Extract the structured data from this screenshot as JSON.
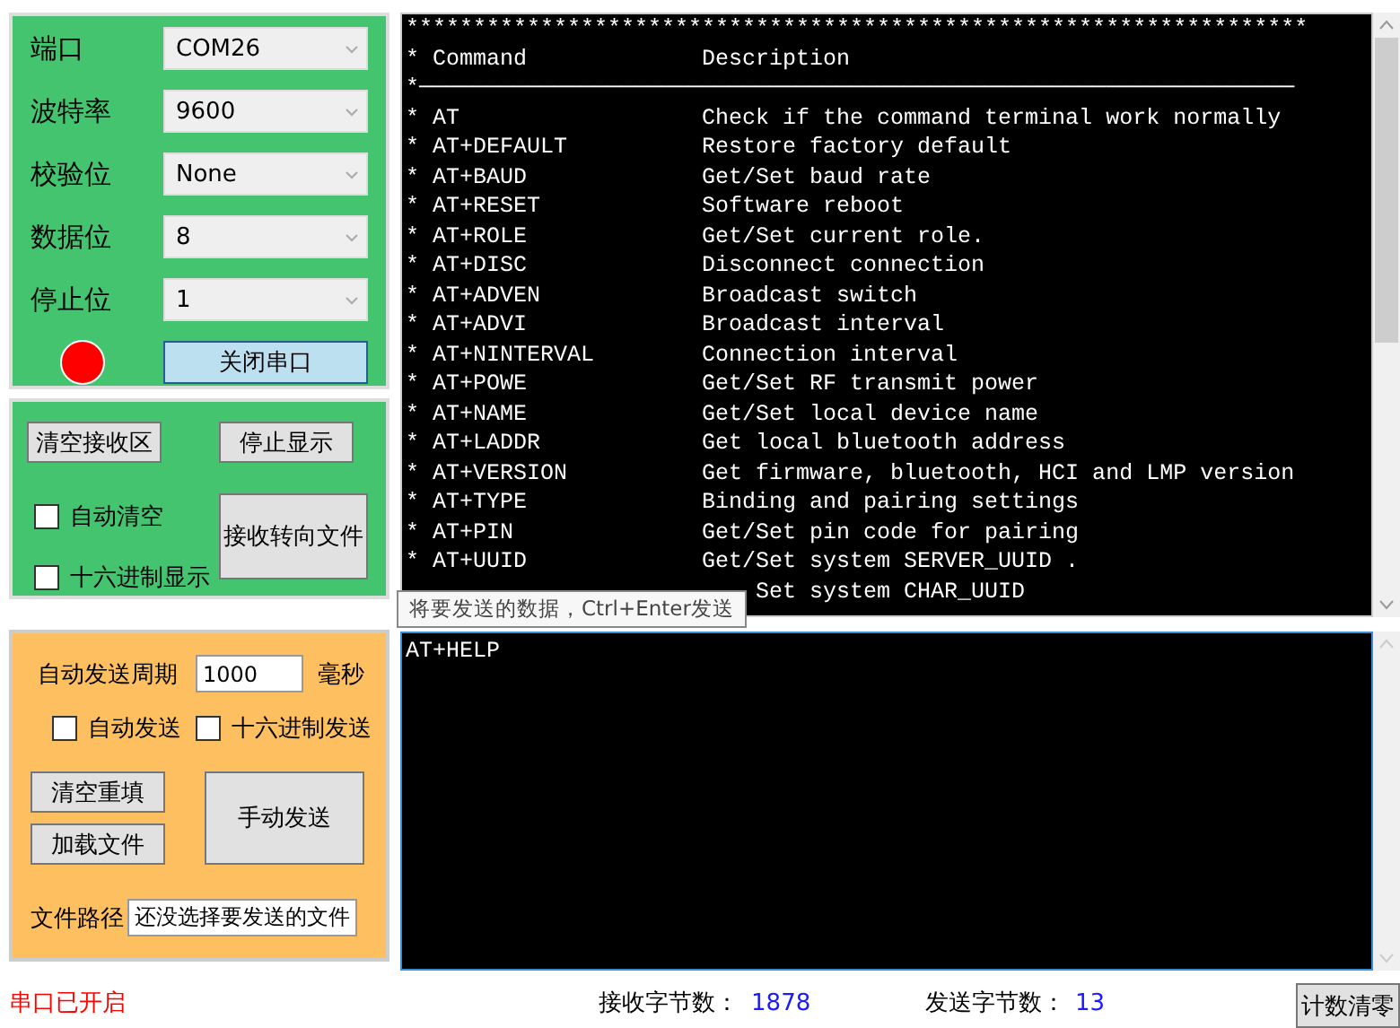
{
  "serial_settings": {
    "fields": [
      {
        "label": "端口",
        "value": "COM26"
      },
      {
        "label": "波特率",
        "value": "9600"
      },
      {
        "label": "校验位",
        "value": "None"
      },
      {
        "label": "数据位",
        "value": "8"
      },
      {
        "label": "停止位",
        "value": "1"
      }
    ],
    "port_button": "关闭串口"
  },
  "receive_options": {
    "clear_button": "清空接收区",
    "stop_button": "停止显示",
    "checkboxes": [
      {
        "label": "自动清空",
        "checked": false
      },
      {
        "label": "十六进制显示",
        "checked": false
      }
    ],
    "redirect_button": "接收转向文件"
  },
  "send_options": {
    "period_label": "自动发送周期",
    "period_value": "1000",
    "period_unit": "毫秒",
    "checkboxes": [
      {
        "label": "自动发送",
        "checked": false
      },
      {
        "label": "十六进制发送",
        "checked": false
      }
    ],
    "reset_button": "清空重填",
    "load_button": "加载文件",
    "send_button": "手动发送",
    "file_path_label": "文件路径",
    "file_path_value": "还没选择要发送的文件"
  },
  "receive_terminal": {
    "lines": [
      {
        "kind": "full",
        "text": "*******************************************************************"
      },
      {
        "kind": "full",
        "text": "* Command             Description"
      },
      {
        "kind": "full",
        "text": "*─────────────────────────────────────────────────────────────────"
      },
      {
        "kind": "full",
        "text": "* AT                  Check if the command terminal work normally"
      },
      {
        "kind": "full",
        "text": "* AT+DEFAULT          Restore factory default"
      },
      {
        "kind": "full",
        "text": "* AT+BAUD             Get/Set baud rate"
      },
      {
        "kind": "full",
        "text": "* AT+RESET            Software reboot"
      },
      {
        "kind": "full",
        "text": "* AT+ROLE             Get/Set current role."
      },
      {
        "kind": "full",
        "text": "* AT+DISC             Disconnect connection"
      },
      {
        "kind": "full",
        "text": "* AT+ADVEN            Broadcast switch"
      },
      {
        "kind": "full",
        "text": "* AT+ADVI             Broadcast interval"
      },
      {
        "kind": "full",
        "text": "* AT+NINTERVAL        Connection interval"
      },
      {
        "kind": "full",
        "text": "* AT+POWE             Get/Set RF transmit power"
      },
      {
        "kind": "full",
        "text": "* AT+NAME             Get/Set local device name"
      },
      {
        "kind": "full",
        "text": "* AT+LADDR            Get local bluetooth address"
      },
      {
        "kind": "full",
        "text": "* AT+VERSION          Get firmware, bluetooth, HCI and LMP version"
      },
      {
        "kind": "full",
        "text": "* AT+TYPE             Binding and pairing settings"
      },
      {
        "kind": "full",
        "text": "* AT+PIN              Get/Set pin code for pairing"
      },
      {
        "kind": "full",
        "text": "* AT+UUID             Get/Set system SERVER_UUID ."
      },
      {
        "kind": "partial",
        "text": "Set system CHAR_UUID"
      }
    ]
  },
  "tooltip": "将要发送的数据，Ctrl+Enter发送",
  "send_terminal": {
    "value": "AT+HELP"
  },
  "status_bar": {
    "port_status": "串口已开启",
    "received_label": "接收字节数：",
    "received_value": "1878",
    "sent_label": "发送字节数：",
    "sent_value": "13",
    "reset_counts_button": "计数清零"
  }
}
